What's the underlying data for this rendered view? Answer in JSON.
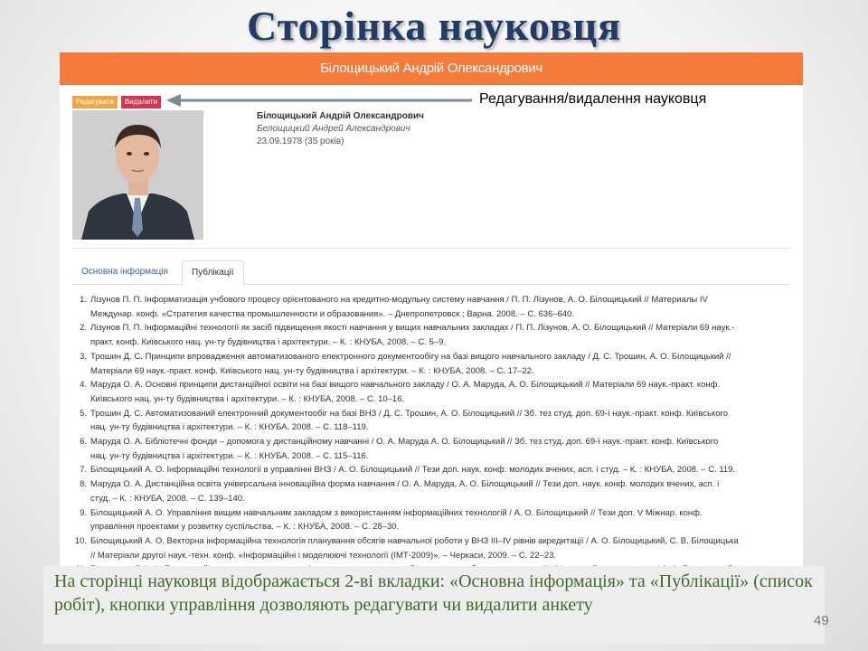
{
  "slide": {
    "title": "Сторінка науковця",
    "caption": "На сторінці науковця відображається 2-ві вкладки: «Основна інформація» та «Публікації» (список робіт), кнопки управління дозволяють редагувати чи видалити анкету",
    "page_number": "49",
    "annotation": "Редагування/видалення науковця"
  },
  "profile": {
    "header": "Білощицький Андрій Олександрович",
    "edit_label": "Редагувати",
    "delete_label": "Видалити",
    "name_ua": "Білощицький Андрій Олександрович",
    "name_ru": "Белощицкий Андрей Александрович",
    "birth": "23.09.1978 (35 років)"
  },
  "tabs": [
    {
      "label": "Основна інформація"
    },
    {
      "label": "Публікації"
    }
  ],
  "publications": [
    {
      "num": "1.",
      "lines": [
        "Лізунов П. П. Інформатизація учбового процесу орієнтованого на кредитно-модульну систему навчання / П. П. Лізунов, А. О. Білощицький // Материалы IV",
        "Междунар. конф. «Стратегия качества промышленности и образования». – Днепропетровск ; Варна. 2008. – С. 636–640."
      ]
    },
    {
      "num": "2.",
      "lines": [
        "Лізунов П. П. Інформаційні технології як засіб підвищення якості навчання у вищих навчальних закладах / П. П. Лізунов, А. О. Білощицький // Матеріали 69 наук.-",
        "практ. конф. Київського нац. ун-ту будівництва і архітектури. – К. : КНУБА, 2008. – С. 5–9."
      ]
    },
    {
      "num": "3.",
      "lines": [
        "Трошин Д. С. Принципи впровадження автоматизованого електронного документообігу на базі вищого навчального закладу / Д. С. Трошин, А. О. Білощицький //",
        "Матеріали 69 наук.-практ. конф. Київського нац. ун-ту будівництва і архітектури. – К. : КНУБА, 2008. – С. 17–22."
      ]
    },
    {
      "num": "4.",
      "lines": [
        "Маруда О. А. Основні принципи дистанційної освіти на базі вищого навчального закладу / О. А. Маруда, А. О. Білощицький // Матеріали 69 наук.-практ. конф.",
        "Київського нац. ун-ту будівництва і архітектури. – К. : КНУБА, 2008. – С. 10–16."
      ]
    },
    {
      "num": "5.",
      "lines": [
        "Трошин Д. С. Автоматизований електронний документообіг на базі ВНЗ / Д. С. Трошин, А. О. Білощицький // Зб. тез студ. доп. 69-ї наук.-практ. конф. Київського",
        "нац. ун-ту будівництва і архітектури. – К. : КНУБА, 2008. – С. 118–119."
      ]
    },
    {
      "num": "6.",
      "lines": [
        "Маруда О. А. Бібліотечні фонди – допомога у дистанційному навчанні / О. А. Маруда А. О. Білощицький // Зб. тез студ. доп. 69-ї наук.-практ. конф. Київського",
        "нац. ун-ту будівництва і архітектури. – К. : КНУБА, 2008. – С. 115–116."
      ]
    },
    {
      "num": "7.",
      "lines": [
        "Білощицький А. О. Інформаційні технології в управлінні ВНЗ / А. О. Білощицький // Тези доп. наук. конф. молодих вчених, асп. і студ. – К. : КНУБА, 2008. – С. 119."
      ]
    },
    {
      "num": "8.",
      "lines": [
        "Маруда О. А. Дистанційна освіта універсальна інноваційна форма навчання / О. А. Маруда, А. О. Білощицький // Тези доп. наук. конф. молодих вчених, асп. і",
        "студ. – К. : КНУБА, 2008. – С. 139–140."
      ]
    },
    {
      "num": "9.",
      "lines": [
        "Білощицький А. О. Управління вищим навчальним закладом з використанням інформаційних технологій / А. О. Білощицький // Тези доп. V Міжнар. конф.",
        "управління проектами у розвитку суспільства. – К. : КНУБА, 2008. – С. 28–30."
      ]
    },
    {
      "num": "10.",
      "lines": [
        "Білощицький А. О. Векторна інформаційна технологія планування обсягів навчальної роботи у ВНЗ ІІІ–IV рівнів акредитації / А. О. Білощицький, С. В. Білощицька",
        "// Матеріали другої наук.-техн. конф. «Інформаційні і моделюючі технології (ІМТ-2009)». – Черкаси, 2009. – С. 22–23."
      ]
    },
    {
      "num": "11.",
      "lines": [
        "Белощицкий А. А. Проектный подход к реализации информационных технологий в высших учебных заведениях III–IV уровней аккредитации / А. А. Белощицкий,",
        "С. В. Белошицкая / Тези доп. VI Міжнар. конф. «Управління проектами у розвитку суспільства». – К. : КНУБА, 2009. – С. 16–17."
      ]
    }
  ],
  "colors": {
    "title": "#1f3b66",
    "orange_bar": "#f47b3a",
    "edit_button": "#f0a540",
    "delete_button": "#d9334f",
    "tab_link": "#2c6aa8",
    "caption_text": "#3d6b2c"
  }
}
